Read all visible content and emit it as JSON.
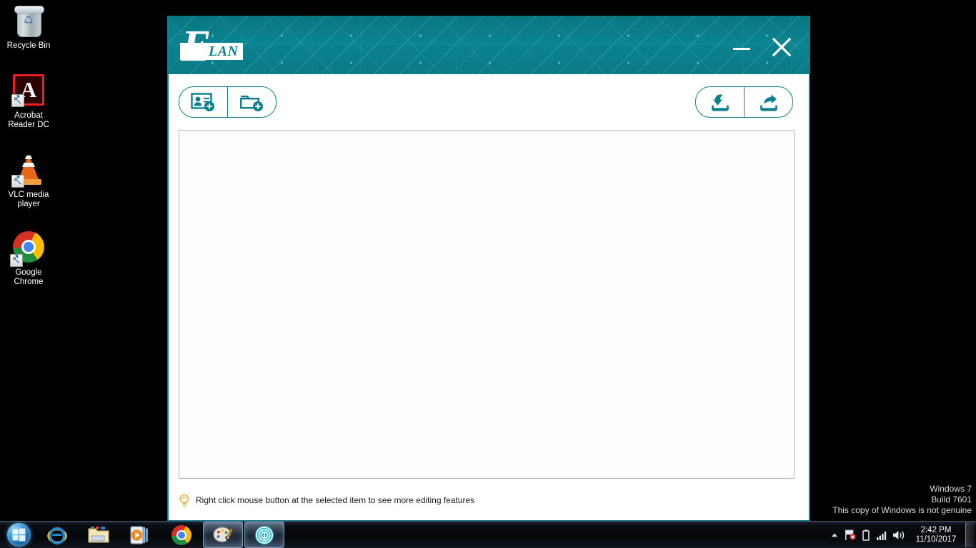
{
  "desktop": {
    "icons": [
      {
        "label": "Recycle Bin",
        "icon": "recycle-bin-icon"
      },
      {
        "label": "Acrobat Reader DC",
        "icon": "acrobat-reader-icon"
      },
      {
        "label": "VLC media player",
        "icon": "vlc-media-player-icon"
      },
      {
        "label": "Google Chrome",
        "icon": "google-chrome-icon"
      }
    ],
    "watermark": {
      "line1": "Windows 7",
      "line2": "Build 7601",
      "line3": "This copy of Windows is not genuine"
    }
  },
  "window": {
    "brand": {
      "letter": "E",
      "word": "LAN",
      "accent": "#0b8390"
    },
    "controls": {
      "minimize_label": "Minimize",
      "close_label": "Close"
    },
    "toolbar": {
      "left": [
        {
          "name": "add-contact-button",
          "tooltip": "Add new user"
        },
        {
          "name": "add-folder-button",
          "tooltip": "Add new folder"
        }
      ],
      "right": [
        {
          "name": "import-button",
          "tooltip": "Import"
        },
        {
          "name": "export-button",
          "tooltip": "Export"
        }
      ]
    },
    "content": {
      "items": []
    },
    "status_hint": "Right click mouse button at the selected item to see more editing features"
  },
  "taskbar": {
    "start_label": "Start",
    "items": [
      {
        "name": "taskbar-internet-explorer",
        "label": "Internet Explorer",
        "active": false
      },
      {
        "name": "taskbar-windows-explorer",
        "label": "Windows Explorer",
        "active": false
      },
      {
        "name": "taskbar-windows-media-player",
        "label": "Windows Media Player",
        "active": false
      },
      {
        "name": "taskbar-google-chrome",
        "label": "Google Chrome",
        "active": false
      },
      {
        "name": "taskbar-paint",
        "label": "Paint",
        "active": true
      },
      {
        "name": "taskbar-elan-fingerprint",
        "label": "ELAN Fingerprint",
        "active": true
      }
    ],
    "tray": {
      "show_hidden_label": "Show hidden icons",
      "action_center_label": "Action Center",
      "battery_label": "Battery",
      "network_label": "Network",
      "volume_label": "Volume"
    },
    "clock": {
      "time": "2:42 PM",
      "date": "11/10/2017"
    }
  }
}
